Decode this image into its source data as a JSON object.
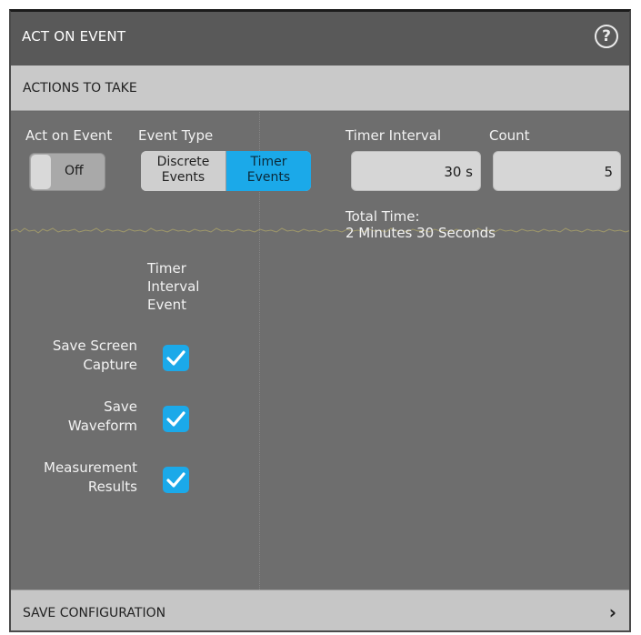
{
  "panel": {
    "title": "ACT ON EVENT",
    "help_icon": "question-circle-icon",
    "help_glyph": "?"
  },
  "actions_header": "ACTIONS TO TAKE",
  "act_on_event": {
    "label": "Act on Event",
    "toggle_state": "Off"
  },
  "event_type": {
    "label": "Event Type",
    "options": [
      {
        "line1": "Discrete",
        "line2": "Events",
        "selected": false
      },
      {
        "line1": "Timer",
        "line2": "Events",
        "selected": true
      }
    ]
  },
  "timer_interval": {
    "label": "Timer Interval",
    "value": "30 s"
  },
  "count": {
    "label": "Count",
    "value": "5"
  },
  "total_time": {
    "label": "Total Time:",
    "value": "2 Minutes 30 Seconds"
  },
  "column_header": {
    "line1": "Timer",
    "line2": "Interval",
    "line3": "Event"
  },
  "actions": [
    {
      "line1": "Save Screen",
      "line2": "Capture",
      "checked": true
    },
    {
      "line1": "Save",
      "line2": "Waveform",
      "checked": true
    },
    {
      "line1": "Measurement",
      "line2": "Results",
      "checked": true
    }
  ],
  "save_config_header": "SAVE CONFIGURATION",
  "chevron_icon": "chevron-right-icon",
  "chevron_glyph": "›",
  "colors": {
    "accent": "#1ba9e9",
    "panel_bg": "#6e6e6e",
    "titlebar_bg": "#595959",
    "section_header_bg": "#c9c9c9",
    "waveform_trace": "#a8a06a"
  }
}
